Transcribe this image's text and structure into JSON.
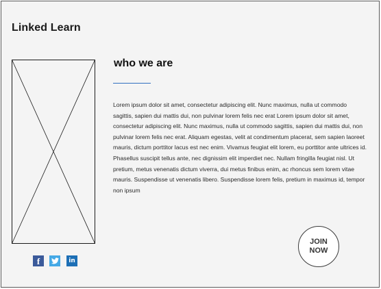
{
  "brand": {
    "title": "Linked Learn"
  },
  "about": {
    "heading": "who we are",
    "body": "Lorem ipsum dolor sit amet, consectetur adipiscing elit. Nunc maximus, nulla ut commodo sagittis, sapien dui mattis dui, non pulvinar lorem felis nec erat Lorem ipsum dolor sit amet, consectetur adipiscing elit. Nunc maximus, nulla ut commodo sagittis, sapien dui mattis dui, non pulvinar lorem felis nec erat. Aliquam egestas, velit at condimentum placerat, sem sapien laoreet mauris, dictum porttitor lacus est nec enim. Vivamus feugiat elit lorem, eu porttitor ante ultrices id. Phasellus suscipit tellus ante, nec dignissim elit imperdiet nec. Nullam fringilla feugiat nisl. Ut pretium, metus venenatis dictum viverra, dui metus finibus enim, ac rhoncus sem lorem vitae mauris. Suspendisse ut venenatis libero. Suspendisse lorem felis, pretium in maximus id, tempor non ipsum",
    "cta_label": "JOIN NOW"
  },
  "social": {
    "facebook": {
      "icon": "facebook-icon",
      "glyph": "f",
      "color": "#3b5a9a"
    },
    "twitter": {
      "icon": "twitter-icon",
      "color": "#45a9e6"
    },
    "linkedin": {
      "icon": "linkedin-icon",
      "glyph": "in",
      "color": "#1d6fb5"
    }
  },
  "colors": {
    "accent": "#2f6fbf",
    "background": "#f4f4f4"
  }
}
